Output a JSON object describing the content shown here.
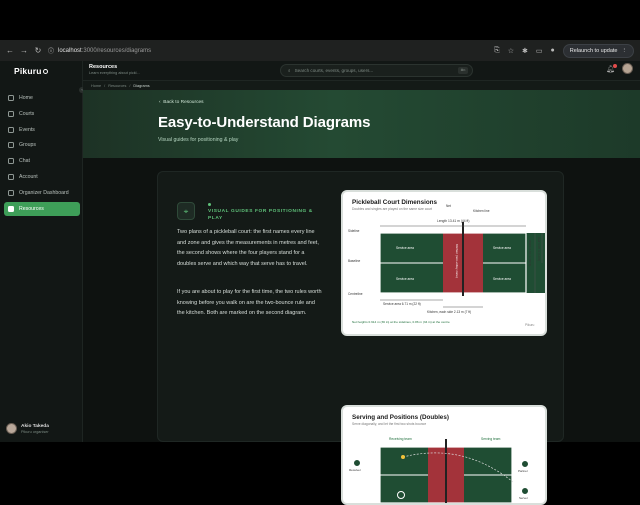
{
  "browser": {
    "url_host": "localhost",
    "url_path": ":3000/resources/diagrams",
    "relaunch_label": "Relaunch to update"
  },
  "sidebar": {
    "logo": "Pikuru",
    "items": [
      {
        "label": "Home",
        "icon": "home-icon"
      },
      {
        "label": "Courts",
        "icon": "court-icon"
      },
      {
        "label": "Events",
        "icon": "calendar-icon"
      },
      {
        "label": "Groups",
        "icon": "users-icon"
      },
      {
        "label": "Chat",
        "icon": "chat-icon"
      },
      {
        "label": "Account",
        "icon": "user-icon"
      },
      {
        "label": "Organizer Dashboard",
        "icon": "dashboard-icon"
      },
      {
        "label": "Resources",
        "icon": "book-icon",
        "active": true
      }
    ],
    "user": {
      "name": "Akio Takeda",
      "role": "Pikuru organiser"
    }
  },
  "topbar": {
    "title": "Resources",
    "subtitle": "Learn everything about pickl...",
    "search_placeholder": "Search courts, events, groups, users...",
    "notification_count": "1"
  },
  "breadcrumb": {
    "items": [
      "Home",
      "Resources"
    ],
    "current": "Diagrams"
  },
  "hero": {
    "back_label": "Back to Resources",
    "title": "Easy-to-Understand Diagrams",
    "subtitle": "Visual guides for positioning & play"
  },
  "content": {
    "kicker": "VISUAL GUIDES FOR POSITIONING & PLAY",
    "para1": "Two plans of a pickleball court: the first names every line and zone and gives the measurements in metres and feet, the second shows where the four players stand for a doubles serve and which way that serve has to travel.",
    "para2": "If you are about to play for the first time, the two rules worth knowing before you walk on are the two-bounce rule and the kitchen. Both are marked on the second diagram."
  },
  "diagram1": {
    "title": "Pickleball Court Dimensions",
    "subtitle": "Doubles and singles are played on the same size court",
    "net_label": "Net",
    "length_label": "Length 13.41 m (44 ft)",
    "kitchen_line": "Kitchen line",
    "sideline": "Sideline",
    "baseline": "Baseline",
    "centreline": "Centreline",
    "service_area": "Service area",
    "service_depth": "Service area 6.71 m (22 ft)",
    "kitchen_depth": "Kitchen, each side 2.13 m (7 ft)",
    "width_label": "Width 6.10 m (20 ft)",
    "half_label": "Half 3.05 m (10 ft)",
    "kitchen_zone": "Kitchen (non-volley zone)",
    "footer": "Net heights 0.914 m (36 in) at the sidelines, 0.86 m (34 in) at the centre",
    "brand": "Pikuru"
  },
  "diagram2": {
    "title": "Serving and Positions (Doubles)",
    "subtitle": "Serve diagonally, and let the first two shots bounce",
    "receiving_team": "Receiving team",
    "serving_team": "Serving team",
    "receiver": "Receiver",
    "partner": "Partner",
    "server": "Server"
  },
  "colors": {
    "accent": "#3e9e58",
    "court_green": "#1f4d33",
    "kitchen_red": "#a3333a"
  }
}
